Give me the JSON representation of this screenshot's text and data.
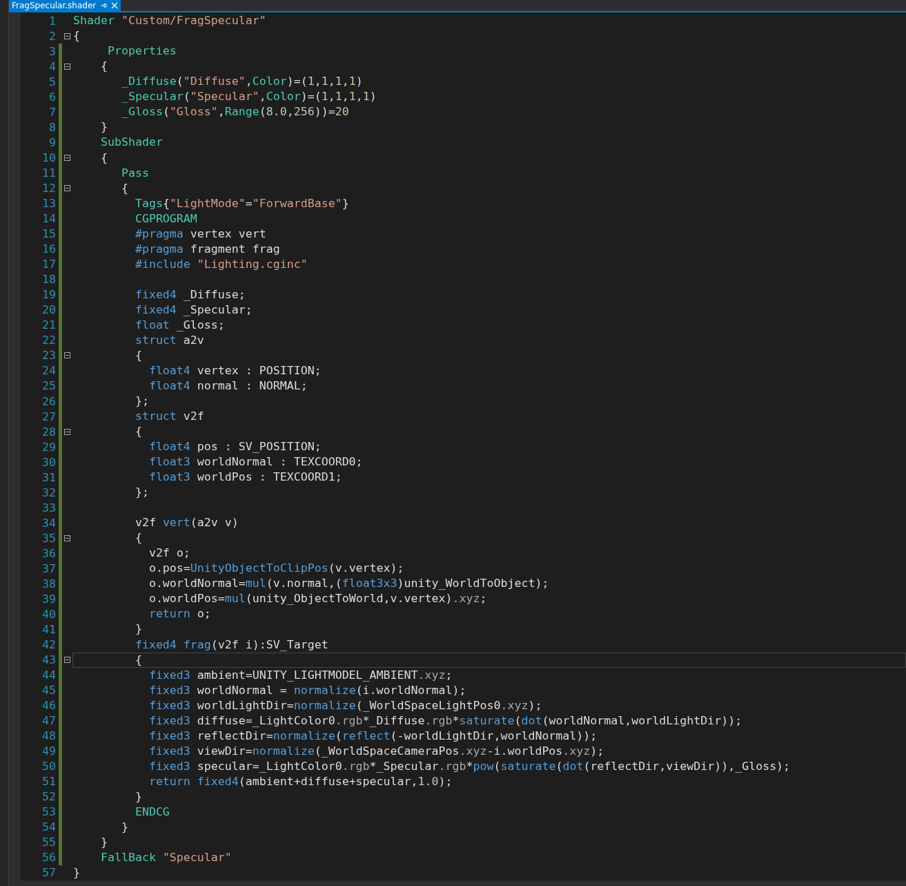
{
  "tab": {
    "title": "FragSpecular.shader",
    "selected": true
  },
  "lines": [
    {
      "number": "1",
      "changed": false,
      "collapsible": false,
      "current": false,
      "tokens": [
        {
          "kind": "type",
          "text": "Shader "
        },
        {
          "kind": "string",
          "text": "\"Custom/FragSpecular\""
        }
      ]
    },
    {
      "number": "2",
      "changed": false,
      "collapsible": true,
      "current": false,
      "tokens": [
        {
          "kind": "plain",
          "text": "{"
        }
      ]
    },
    {
      "number": "3",
      "changed": true,
      "collapsible": false,
      "current": false,
      "tokens": [
        {
          "kind": "type",
          "text": "     Properties"
        }
      ]
    },
    {
      "number": "4",
      "changed": true,
      "collapsible": true,
      "current": false,
      "tokens": [
        {
          "kind": "plain",
          "text": "    {"
        }
      ]
    },
    {
      "number": "5",
      "changed": true,
      "collapsible": false,
      "current": false,
      "tokens": [
        {
          "kind": "type",
          "text": "       _Diffuse"
        },
        {
          "kind": "plain",
          "text": "("
        },
        {
          "kind": "string",
          "text": "\"Diffuse\""
        },
        {
          "kind": "plain",
          "text": ","
        },
        {
          "kind": "type",
          "text": "Color"
        },
        {
          "kind": "plain",
          "text": ")=("
        },
        {
          "kind": "number",
          "text": "1"
        },
        {
          "kind": "plain",
          "text": ","
        },
        {
          "kind": "number",
          "text": "1"
        },
        {
          "kind": "plain",
          "text": ","
        },
        {
          "kind": "number",
          "text": "1"
        },
        {
          "kind": "plain",
          "text": ","
        },
        {
          "kind": "number",
          "text": "1"
        },
        {
          "kind": "plain",
          "text": ")"
        }
      ]
    },
    {
      "number": "6",
      "changed": true,
      "collapsible": false,
      "current": false,
      "tokens": [
        {
          "kind": "type",
          "text": "       _Specular"
        },
        {
          "kind": "plain",
          "text": "("
        },
        {
          "kind": "string",
          "text": "\"Specular\""
        },
        {
          "kind": "plain",
          "text": ","
        },
        {
          "kind": "type",
          "text": "Color"
        },
        {
          "kind": "plain",
          "text": ")=("
        },
        {
          "kind": "number",
          "text": "1"
        },
        {
          "kind": "plain",
          "text": ","
        },
        {
          "kind": "number",
          "text": "1"
        },
        {
          "kind": "plain",
          "text": ","
        },
        {
          "kind": "number",
          "text": "1"
        },
        {
          "kind": "plain",
          "text": ","
        },
        {
          "kind": "number",
          "text": "1"
        },
        {
          "kind": "plain",
          "text": ")"
        }
      ]
    },
    {
      "number": "7",
      "changed": true,
      "collapsible": false,
      "current": false,
      "tokens": [
        {
          "kind": "type",
          "text": "       _Gloss"
        },
        {
          "kind": "plain",
          "text": "("
        },
        {
          "kind": "string",
          "text": "\"Gloss\""
        },
        {
          "kind": "plain",
          "text": ","
        },
        {
          "kind": "type",
          "text": "Range"
        },
        {
          "kind": "plain",
          "text": "("
        },
        {
          "kind": "number",
          "text": "8.0"
        },
        {
          "kind": "plain",
          "text": ","
        },
        {
          "kind": "number",
          "text": "256"
        },
        {
          "kind": "plain",
          "text": "))="
        },
        {
          "kind": "number",
          "text": "20"
        }
      ]
    },
    {
      "number": "8",
      "changed": true,
      "collapsible": false,
      "current": false,
      "tokens": [
        {
          "kind": "plain",
          "text": "    }"
        }
      ]
    },
    {
      "number": "9",
      "changed": true,
      "collapsible": false,
      "current": false,
      "tokens": [
        {
          "kind": "type",
          "text": "    SubShader"
        }
      ]
    },
    {
      "number": "10",
      "changed": true,
      "collapsible": true,
      "current": false,
      "tokens": [
        {
          "kind": "plain",
          "text": "    {"
        }
      ]
    },
    {
      "number": "11",
      "changed": true,
      "collapsible": false,
      "current": false,
      "tokens": [
        {
          "kind": "type",
          "text": "       Pass"
        }
      ]
    },
    {
      "number": "12",
      "changed": true,
      "collapsible": true,
      "current": false,
      "tokens": [
        {
          "kind": "plain",
          "text": "       {"
        }
      ]
    },
    {
      "number": "13",
      "changed": true,
      "collapsible": false,
      "current": false,
      "tokens": [
        {
          "kind": "type",
          "text": "         Tags"
        },
        {
          "kind": "plain",
          "text": "{"
        },
        {
          "kind": "string",
          "text": "\"LightMode\""
        },
        {
          "kind": "plain",
          "text": "="
        },
        {
          "kind": "string",
          "text": "\"ForwardBase\""
        },
        {
          "kind": "plain",
          "text": "}"
        }
      ]
    },
    {
      "number": "14",
      "changed": true,
      "collapsible": false,
      "current": false,
      "tokens": [
        {
          "kind": "type",
          "text": "         CGPROGRAM"
        }
      ]
    },
    {
      "number": "15",
      "changed": true,
      "collapsible": false,
      "current": false,
      "tokens": [
        {
          "kind": "keyword",
          "text": "         #pragma"
        },
        {
          "kind": "plain",
          "text": " vertex vert"
        }
      ]
    },
    {
      "number": "16",
      "changed": true,
      "collapsible": false,
      "current": false,
      "tokens": [
        {
          "kind": "keyword",
          "text": "         #pragma"
        },
        {
          "kind": "plain",
          "text": " fragment frag"
        }
      ]
    },
    {
      "number": "17",
      "changed": true,
      "collapsible": false,
      "current": false,
      "tokens": [
        {
          "kind": "keyword",
          "text": "         #include "
        },
        {
          "kind": "string",
          "text": "\"Lighting.cginc\""
        }
      ]
    },
    {
      "number": "18",
      "changed": true,
      "collapsible": false,
      "current": false
    },
    {
      "number": "19",
      "changed": true,
      "collapsible": false,
      "current": false,
      "tokens": [
        {
          "kind": "keyword",
          "text": "         fixed4"
        },
        {
          "kind": "plain",
          "text": " _Diffuse;"
        }
      ]
    },
    {
      "number": "20",
      "changed": true,
      "collapsible": false,
      "current": false,
      "tokens": [
        {
          "kind": "keyword",
          "text": "         fixed4"
        },
        {
          "kind": "plain",
          "text": " _Specular;"
        }
      ]
    },
    {
      "number": "21",
      "changed": true,
      "collapsible": false,
      "current": false,
      "tokens": [
        {
          "kind": "keyword",
          "text": "         float"
        },
        {
          "kind": "plain",
          "text": " _Gloss;"
        }
      ]
    },
    {
      "number": "22",
      "changed": true,
      "collapsible": false,
      "current": false,
      "tokens": [
        {
          "kind": "keyword",
          "text": "         struct"
        },
        {
          "kind": "plain",
          "text": " a2v"
        }
      ]
    },
    {
      "number": "23",
      "changed": true,
      "collapsible": true,
      "current": false,
      "tokens": [
        {
          "kind": "plain",
          "text": "         {"
        }
      ]
    },
    {
      "number": "24",
      "changed": true,
      "collapsible": false,
      "current": false,
      "tokens": [
        {
          "kind": "keyword",
          "text": "           float4"
        },
        {
          "kind": "plain",
          "text": " vertex : POSITION;"
        }
      ]
    },
    {
      "number": "25",
      "changed": true,
      "collapsible": false,
      "current": false,
      "tokens": [
        {
          "kind": "keyword",
          "text": "           float4"
        },
        {
          "kind": "plain",
          "text": " normal : NORMAL;"
        }
      ]
    },
    {
      "number": "26",
      "changed": true,
      "collapsible": false,
      "current": false,
      "tokens": [
        {
          "kind": "plain",
          "text": "         };"
        }
      ]
    },
    {
      "number": "27",
      "changed": true,
      "collapsible": false,
      "current": false,
      "tokens": [
        {
          "kind": "keyword",
          "text": "         struct"
        },
        {
          "kind": "plain",
          "text": " v2f"
        }
      ]
    },
    {
      "number": "28",
      "changed": true,
      "collapsible": true,
      "current": false,
      "tokens": [
        {
          "kind": "plain",
          "text": "         {"
        }
      ]
    },
    {
      "number": "29",
      "changed": true,
      "collapsible": false,
      "current": false,
      "tokens": [
        {
          "kind": "keyword",
          "text": "           float4"
        },
        {
          "kind": "plain",
          "text": " pos : SV_POSITION;"
        }
      ]
    },
    {
      "number": "30",
      "changed": true,
      "collapsible": false,
      "current": false,
      "tokens": [
        {
          "kind": "keyword",
          "text": "           float3"
        },
        {
          "kind": "plain",
          "text": " worldNormal : TEXCOORD0;"
        }
      ]
    },
    {
      "number": "31",
      "changed": true,
      "collapsible": false,
      "current": false,
      "tokens": [
        {
          "kind": "keyword",
          "text": "           float3"
        },
        {
          "kind": "plain",
          "text": " worldPos : TEXCOORD1;"
        }
      ]
    },
    {
      "number": "32",
      "changed": true,
      "collapsible": false,
      "current": false,
      "tokens": [
        {
          "kind": "plain",
          "text": "         };"
        }
      ]
    },
    {
      "number": "33",
      "changed": true,
      "collapsible": false,
      "current": false
    },
    {
      "number": "34",
      "changed": true,
      "collapsible": false,
      "current": false,
      "tokens": [
        {
          "kind": "plain",
          "text": "         v2f "
        },
        {
          "kind": "keyword",
          "text": "vert"
        },
        {
          "kind": "plain",
          "text": "(a2v v)"
        }
      ]
    },
    {
      "number": "35",
      "changed": true,
      "collapsible": true,
      "current": false,
      "tokens": [
        {
          "kind": "plain",
          "text": "         {"
        }
      ]
    },
    {
      "number": "36",
      "changed": true,
      "collapsible": false,
      "current": false,
      "tokens": [
        {
          "kind": "plain",
          "text": "           v2f o;"
        }
      ]
    },
    {
      "number": "37",
      "changed": true,
      "collapsible": false,
      "current": false,
      "tokens": [
        {
          "kind": "plain",
          "text": "           o.pos="
        },
        {
          "kind": "keyword",
          "text": "UnityObjectToClipPos"
        },
        {
          "kind": "plain",
          "text": "(v.vertex);"
        }
      ]
    },
    {
      "number": "38",
      "changed": true,
      "collapsible": false,
      "current": false,
      "tokens": [
        {
          "kind": "plain",
          "text": "           o.worldNormal="
        },
        {
          "kind": "keyword",
          "text": "mul"
        },
        {
          "kind": "plain",
          "text": "(v.normal,("
        },
        {
          "kind": "keyword",
          "text": "float3x3"
        },
        {
          "kind": "plain",
          "text": ")unity_WorldToObject);"
        }
      ]
    },
    {
      "number": "39",
      "changed": true,
      "collapsible": false,
      "current": false,
      "tokens": [
        {
          "kind": "plain",
          "text": "           o.worldPos="
        },
        {
          "kind": "keyword",
          "text": "mul"
        },
        {
          "kind": "plain",
          "text": "(unity_ObjectToWorld,v.vertex)"
        },
        {
          "kind": "member",
          "text": ".xyz"
        },
        {
          "kind": "plain",
          "text": ";"
        }
      ]
    },
    {
      "number": "40",
      "changed": true,
      "collapsible": false,
      "current": false,
      "tokens": [
        {
          "kind": "keyword",
          "text": "           return"
        },
        {
          "kind": "plain",
          "text": " o;"
        }
      ]
    },
    {
      "number": "41",
      "changed": true,
      "collapsible": false,
      "current": false,
      "tokens": [
        {
          "kind": "plain",
          "text": "         }"
        }
      ]
    },
    {
      "number": "42",
      "changed": true,
      "collapsible": false,
      "current": false,
      "tokens": [
        {
          "kind": "keyword",
          "text": "         fixed4 frag"
        },
        {
          "kind": "plain",
          "text": "(v2f i):SV_Target"
        }
      ]
    },
    {
      "number": "43",
      "changed": true,
      "collapsible": true,
      "current": true,
      "tokens": [
        {
          "kind": "plain",
          "text": "         {"
        }
      ]
    },
    {
      "number": "44",
      "changed": true,
      "collapsible": false,
      "current": false,
      "tokens": [
        {
          "kind": "keyword",
          "text": "           fixed3"
        },
        {
          "kind": "plain",
          "text": " ambient=UNITY_LIGHTMODEL_AMBIENT"
        },
        {
          "kind": "member",
          "text": ".xyz"
        },
        {
          "kind": "plain",
          "text": ";"
        }
      ]
    },
    {
      "number": "45",
      "changed": true,
      "collapsible": false,
      "current": false,
      "tokens": [
        {
          "kind": "keyword",
          "text": "           fixed3"
        },
        {
          "kind": "plain",
          "text": " worldNormal = "
        },
        {
          "kind": "keyword",
          "text": "normalize"
        },
        {
          "kind": "plain",
          "text": "(i.worldNormal);"
        }
      ]
    },
    {
      "number": "46",
      "changed": true,
      "collapsible": false,
      "current": false,
      "tokens": [
        {
          "kind": "keyword",
          "text": "           fixed3"
        },
        {
          "kind": "plain",
          "text": " worldLightDir="
        },
        {
          "kind": "keyword",
          "text": "normalize"
        },
        {
          "kind": "plain",
          "text": "(_WorldSpaceLightPos0"
        },
        {
          "kind": "member",
          "text": ".xyz"
        },
        {
          "kind": "plain",
          "text": ");"
        }
      ]
    },
    {
      "number": "47",
      "changed": true,
      "collapsible": false,
      "current": false,
      "tokens": [
        {
          "kind": "keyword",
          "text": "           fixed3"
        },
        {
          "kind": "plain",
          "text": " diffuse=_LightColor0"
        },
        {
          "kind": "member",
          "text": ".rgb"
        },
        {
          "kind": "plain",
          "text": "*_Diffuse"
        },
        {
          "kind": "member",
          "text": ".rgb"
        },
        {
          "kind": "plain",
          "text": "*"
        },
        {
          "kind": "keyword",
          "text": "saturate"
        },
        {
          "kind": "plain",
          "text": "("
        },
        {
          "kind": "keyword",
          "text": "dot"
        },
        {
          "kind": "plain",
          "text": "(worldNormal,worldLightDir));"
        }
      ]
    },
    {
      "number": "48",
      "changed": true,
      "collapsible": false,
      "current": false,
      "tokens": [
        {
          "kind": "keyword",
          "text": "           fixed3"
        },
        {
          "kind": "plain",
          "text": " reflectDir="
        },
        {
          "kind": "keyword",
          "text": "normalize"
        },
        {
          "kind": "plain",
          "text": "("
        },
        {
          "kind": "keyword",
          "text": "reflect"
        },
        {
          "kind": "plain",
          "text": "(-worldLightDir,worldNormal));"
        }
      ]
    },
    {
      "number": "49",
      "changed": true,
      "collapsible": false,
      "current": false,
      "tokens": [
        {
          "kind": "keyword",
          "text": "           fixed3"
        },
        {
          "kind": "plain",
          "text": " viewDir="
        },
        {
          "kind": "keyword",
          "text": "normalize"
        },
        {
          "kind": "plain",
          "text": "(_WorldSpaceCameraPos"
        },
        {
          "kind": "member",
          "text": ".xyz"
        },
        {
          "kind": "plain",
          "text": "-i.worldPos"
        },
        {
          "kind": "member",
          "text": ".xyz"
        },
        {
          "kind": "plain",
          "text": ");"
        }
      ]
    },
    {
      "number": "50",
      "changed": true,
      "collapsible": false,
      "current": false,
      "tokens": [
        {
          "kind": "keyword",
          "text": "           fixed3"
        },
        {
          "kind": "plain",
          "text": " specular=_LightColor0"
        },
        {
          "kind": "member",
          "text": ".rgb"
        },
        {
          "kind": "plain",
          "text": "*_Specular"
        },
        {
          "kind": "member",
          "text": ".rgb"
        },
        {
          "kind": "plain",
          "text": "*"
        },
        {
          "kind": "keyword",
          "text": "pow"
        },
        {
          "kind": "plain",
          "text": "("
        },
        {
          "kind": "keyword",
          "text": "saturate"
        },
        {
          "kind": "plain",
          "text": "("
        },
        {
          "kind": "keyword",
          "text": "dot"
        },
        {
          "kind": "plain",
          "text": "(reflectDir,viewDir)),_Gloss);"
        }
      ]
    },
    {
      "number": "51",
      "changed": true,
      "collapsible": false,
      "current": false,
      "tokens": [
        {
          "kind": "keyword",
          "text": "           return fixed4"
        },
        {
          "kind": "plain",
          "text": "(ambient+diffuse+specular,"
        },
        {
          "kind": "number",
          "text": "1.0"
        },
        {
          "kind": "plain",
          "text": ");"
        }
      ]
    },
    {
      "number": "52",
      "changed": true,
      "collapsible": false,
      "current": false,
      "tokens": [
        {
          "kind": "plain",
          "text": "         }"
        }
      ]
    },
    {
      "number": "53",
      "changed": true,
      "collapsible": false,
      "current": false,
      "tokens": [
        {
          "kind": "type",
          "text": "         ENDCG"
        }
      ]
    },
    {
      "number": "54",
      "changed": true,
      "collapsible": false,
      "current": false,
      "tokens": [
        {
          "kind": "plain",
          "text": "       }"
        }
      ]
    },
    {
      "number": "55",
      "changed": true,
      "collapsible": false,
      "current": false,
      "tokens": [
        {
          "kind": "plain",
          "text": "    }"
        }
      ]
    },
    {
      "number": "56",
      "changed": true,
      "collapsible": false,
      "current": false,
      "tokens": [
        {
          "kind": "type",
          "text": "    FallBack "
        },
        {
          "kind": "string",
          "text": "\"Specular\""
        }
      ]
    },
    {
      "number": "57",
      "changed": false,
      "collapsible": false,
      "current": false,
      "tokens": [
        {
          "kind": "plain",
          "text": "}"
        }
      ]
    }
  ]
}
